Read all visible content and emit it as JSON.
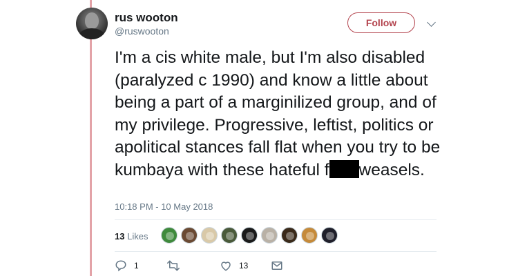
{
  "user": {
    "name": "rus wooton",
    "handle": "@ruswooton"
  },
  "follow_button": "Follow",
  "tweet": {
    "text_before": "I'm a cis white male, but I'm also disabled (paralyzed c 1990) and know a little about being a part of a marginilized group, and of my privilege. Progressive, leftist, politics or apolitical stances fall flat when you try to be kumbaya with these hateful f",
    "text_after": "weasels.",
    "timestamp": "10:18 PM - 10 May 2018"
  },
  "likes": {
    "count": "13",
    "label": "Likes",
    "avatar_colors": [
      "#3f8a3c",
      "#6b4a33",
      "#d9c9a8",
      "#4a5a3a",
      "#1a1a1a",
      "#b9b1a6",
      "#3a2a1a",
      "#c58a3a",
      "#1f1f2a"
    ]
  },
  "actions": {
    "replies": "1",
    "retweets": "",
    "likes": "13"
  },
  "colors": {
    "accent": "#b3434d",
    "thread_line": "#e3a3a8",
    "secondary_text": "#657786"
  },
  "icons": [
    "caret-down-icon",
    "reply-icon",
    "retweet-icon",
    "heart-icon",
    "envelope-icon"
  ]
}
